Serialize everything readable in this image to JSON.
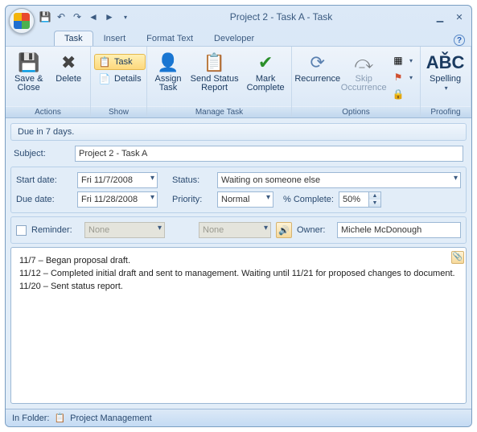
{
  "window": {
    "title": "Project 2 - Task A - Task"
  },
  "qat": [
    "save",
    "undo",
    "redo",
    "prev",
    "next"
  ],
  "tabs": {
    "active": "Task",
    "items": [
      "Task",
      "Insert",
      "Format Text",
      "Developer"
    ]
  },
  "ribbon": {
    "actions": {
      "title": "Actions",
      "save_close": "Save &\nClose",
      "delete": "Delete"
    },
    "show": {
      "title": "Show",
      "task": "Task",
      "details": "Details"
    },
    "manage": {
      "title": "Manage Task",
      "assign": "Assign\nTask",
      "send_status": "Send Status\nReport",
      "mark_complete": "Mark\nComplete"
    },
    "options": {
      "title": "Options",
      "recurrence": "Recurrence",
      "skip": "Skip\nOccurrence",
      "categorize": "",
      "followup": "",
      "private": ""
    },
    "proofing": {
      "title": "Proofing",
      "spelling": "Spelling"
    }
  },
  "infobar": "Due in 7 days.",
  "fields": {
    "subject_label": "Subject:",
    "subject": "Project 2 - Task A",
    "start_label": "Start date:",
    "start": "Fri 11/7/2008",
    "due_label": "Due date:",
    "due": "Fri 11/28/2008",
    "status_label": "Status:",
    "status": "Waiting on someone else",
    "priority_label": "Priority:",
    "priority": "Normal",
    "complete_label": "% Complete:",
    "complete": "50%",
    "reminder_label": "Reminder:",
    "reminder_date": "None",
    "reminder_time": "None",
    "owner_label": "Owner:",
    "owner": "Michele McDonough"
  },
  "notes": {
    "l1": "11/7 – Began proposal draft.",
    "l2": "11/12 – Completed initial draft and sent to management. Waiting until 11/21 for proposed changes to document.",
    "l3": "11/20 – Sent status report."
  },
  "status": {
    "in_folder_label": "In Folder:",
    "folder": "Project Management"
  }
}
